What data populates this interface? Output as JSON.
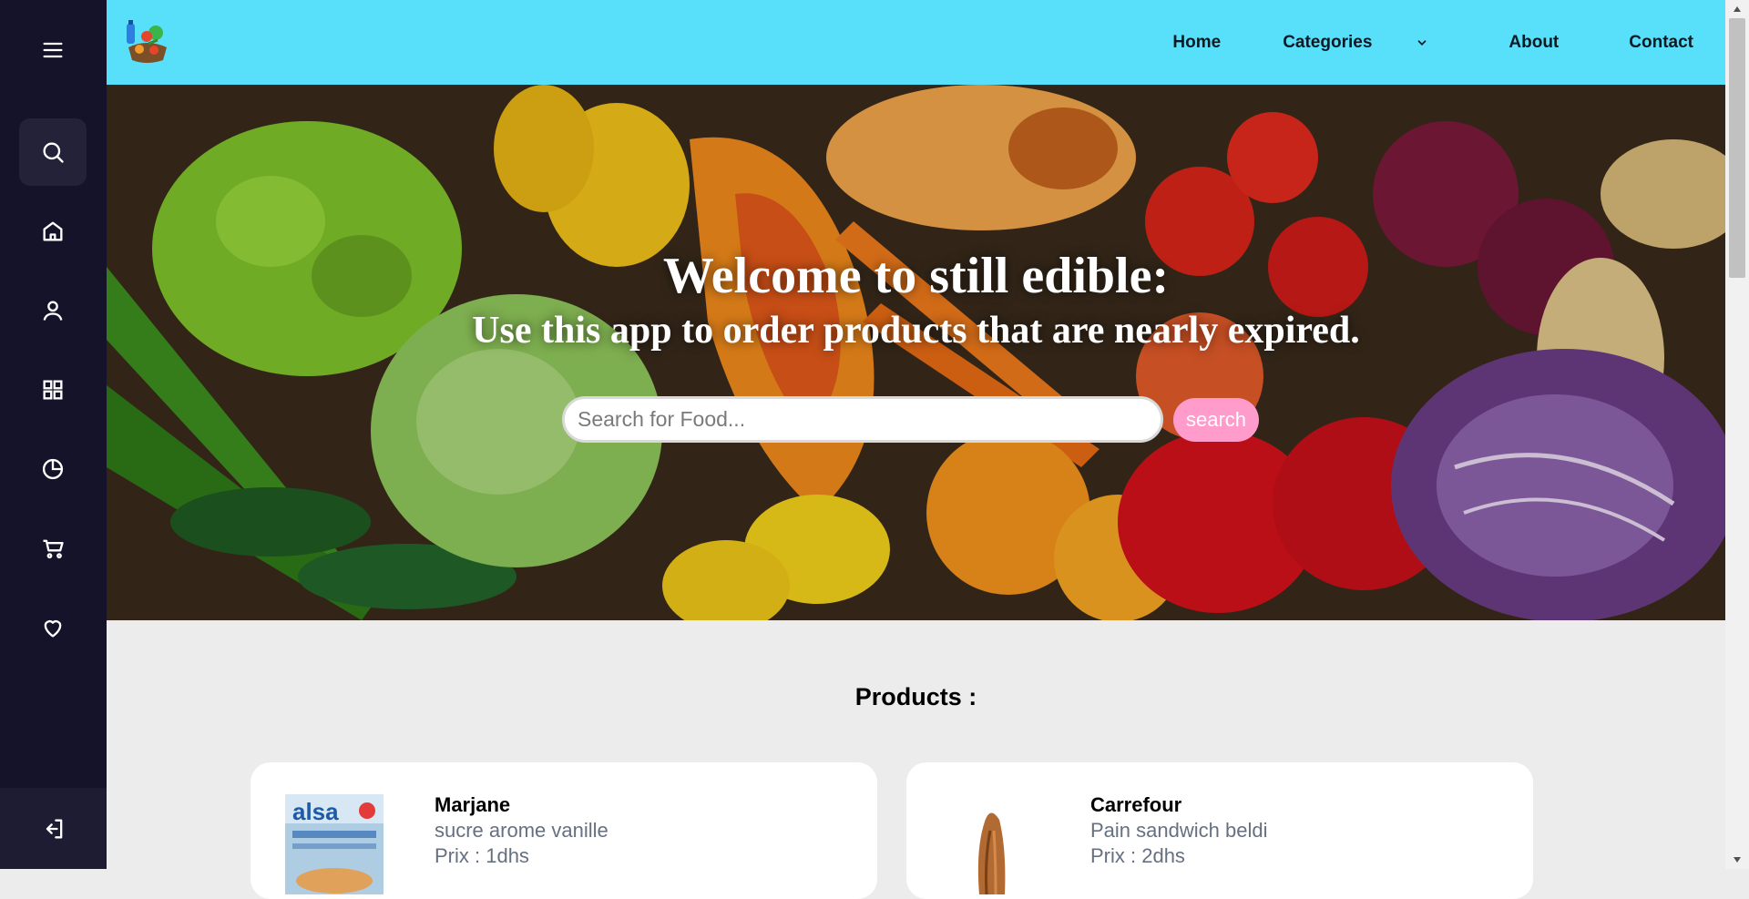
{
  "nav": {
    "home": "Home",
    "categories": "Categories",
    "about": "About",
    "contact": "Contact"
  },
  "hero": {
    "title": "Welcome to still edible:",
    "subtitle": "Use this app to order products that are nearly expired.",
    "search_placeholder": "Search for Food...",
    "search_button": "search"
  },
  "sidebar": {
    "items": [
      "menu-icon",
      "search-icon",
      "home-icon",
      "user-icon",
      "grid-icon",
      "pie-chart-icon",
      "cart-icon",
      "heart-icon"
    ],
    "bottom": "logout-icon"
  },
  "products": {
    "title": "Products :",
    "items": [
      {
        "store": "Marjane",
        "name": "sucre arome vanille",
        "price": "Prix : 1dhs",
        "image_text": "alsa"
      },
      {
        "store": "Carrefour",
        "name": "Pain sandwich beldi",
        "price": "Prix : 2dhs"
      }
    ]
  },
  "colors": {
    "sidebar": "#15132a",
    "header": "#58dffa",
    "search_button": "#ff9ccc",
    "background": "#ececec"
  }
}
